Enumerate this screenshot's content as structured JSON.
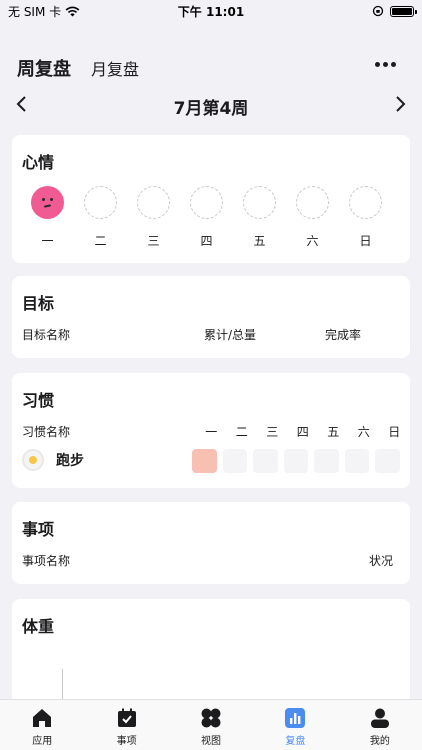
{
  "status_bar": {
    "carrier": "无 SIM 卡",
    "time": "下午 11:01"
  },
  "header": {
    "tab_week": "周复盘",
    "tab_month": "月复盘",
    "week_title": "7月第4周"
  },
  "mood": {
    "title": "心情",
    "days": [
      "一",
      "二",
      "三",
      "四",
      "五",
      "六",
      "日"
    ],
    "recorded": [
      true,
      false,
      false,
      false,
      false,
      false,
      false
    ]
  },
  "goals": {
    "title": "目标",
    "col_name": "目标名称",
    "col_total": "累计/总量",
    "col_rate": "完成率"
  },
  "habits": {
    "title": "习惯",
    "col_name": "习惯名称",
    "days": [
      "一",
      "二",
      "三",
      "四",
      "五",
      "六",
      "日"
    ],
    "items": [
      {
        "name": "跑步",
        "icon": "fried-egg-icon",
        "done": [
          true,
          false,
          false,
          false,
          false,
          false,
          false
        ]
      }
    ]
  },
  "tasks": {
    "title": "事项",
    "col_name": "事项名称",
    "col_status": "状况"
  },
  "weight": {
    "title": "体重"
  },
  "tab_bar": {
    "items": [
      {
        "label": "应用",
        "icon": "home-icon",
        "active": false
      },
      {
        "label": "事项",
        "icon": "calendar-check-icon",
        "active": false
      },
      {
        "label": "视图",
        "icon": "grid-petals-icon",
        "active": false
      },
      {
        "label": "复盘",
        "icon": "bar-chart-icon",
        "active": true
      },
      {
        "label": "我的",
        "icon": "user-icon",
        "active": false
      }
    ],
    "active_color": "#4a8cf0"
  }
}
